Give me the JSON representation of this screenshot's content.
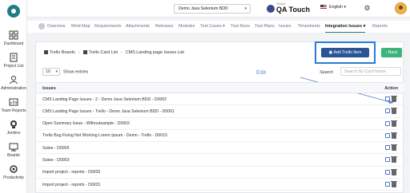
{
  "sidebar": {
    "items": [
      {
        "label": "Dashboard",
        "icon": "dashboard-icon"
      },
      {
        "label": "Project List",
        "icon": "project-list-icon"
      },
      {
        "label": "Administration",
        "icon": "administration-icon"
      },
      {
        "label": "Team Reports",
        "icon": "team-reports-icon"
      },
      {
        "label": "Jenkins",
        "icon": "jenkins-icon"
      },
      {
        "label": "Boards",
        "icon": "boards-icon"
      },
      {
        "label": "Productivity",
        "icon": "productivity-icon"
      }
    ]
  },
  "topbar": {
    "project": "Demo Java Selenium BDD",
    "brand_small": "Tenant",
    "brand_name": "QA Touch",
    "language": "English"
  },
  "tabs": [
    {
      "label": "Overview"
    },
    {
      "label": "Mind Map"
    },
    {
      "label": "Requirements"
    },
    {
      "label": "Attachments"
    },
    {
      "label": "Releases"
    },
    {
      "label": "Modules"
    },
    {
      "label": "Test Cases ▾"
    },
    {
      "label": "Test Runs"
    },
    {
      "label": "Test Plans"
    },
    {
      "label": "Issues"
    },
    {
      "label": "Timesheets"
    },
    {
      "label": "Integration Issues ▾"
    },
    {
      "label": "Reports"
    }
  ],
  "active_tab": "Integration Issues ▾",
  "breadcrumb": {
    "boards": "Trello Boards",
    "card_list": "Trello Card List",
    "current": "CMS Landing page Issues List"
  },
  "actions": {
    "add_label": "Add Trello Item",
    "back_label": "Back"
  },
  "entries": {
    "value": "10",
    "label": "Show entries"
  },
  "annotation": "Edit",
  "search": {
    "label": "Search",
    "placeholder": "Search By Card Name"
  },
  "table": {
    "col_issues": "Issues",
    "col_action": "Action",
    "rows": [
      "CMS Landing Page Issues - 2 - Demo Java Selenium BDD - D0002",
      "CMS Landing Page Issues - Trello - Demo Java Selenium BDD - D0001",
      "Open Summary Issue - Withoutsample - D0002",
      "Trello Bug Fixing Not Working Lorem Ipsum - Demo - Trello - D0015",
      "Sutee - D0005",
      "Sutee - D0003",
      "Import project - reports - D0032",
      "Import project - reports - D0031"
    ]
  }
}
